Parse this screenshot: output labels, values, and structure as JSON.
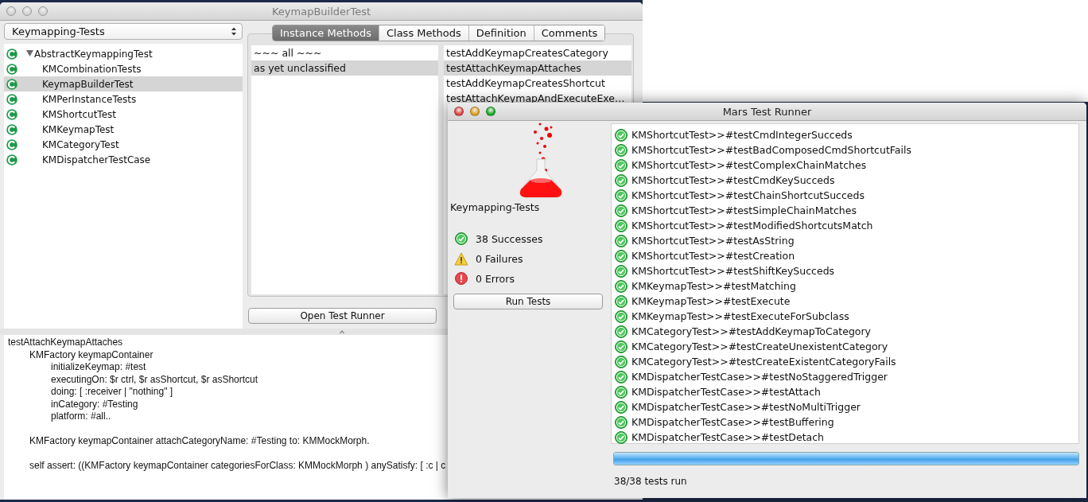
{
  "browser_window": {
    "title": "KeymapBuilderTest",
    "active": false,
    "package_dropdown": {
      "value": "Keymapping-Tests"
    },
    "class_tree": [
      {
        "name": "AbstractKeymappingTest",
        "selected": false,
        "expanded": true,
        "children": [
          {
            "name": "KMCombinationTests",
            "selected": false
          },
          {
            "name": "KeymapBuilderTest",
            "selected": true
          },
          {
            "name": "KMPerInstanceTests",
            "selected": false
          },
          {
            "name": "KMShortcutTest",
            "selected": false
          },
          {
            "name": "KMKeymapTest",
            "selected": false
          },
          {
            "name": "KMCategoryTest",
            "selected": false
          },
          {
            "name": "KMDispatcherTestCase",
            "selected": false
          }
        ]
      }
    ],
    "tabs": [
      {
        "label": "Instance Methods",
        "selected": true
      },
      {
        "label": "Class Methods",
        "selected": false
      },
      {
        "label": "Definition",
        "selected": false
      },
      {
        "label": "Comments",
        "selected": false
      }
    ],
    "protocols": [
      {
        "label": "~~~ all ~~~",
        "selected": false
      },
      {
        "label": "as yet unclassified",
        "selected": true
      }
    ],
    "methods": [
      {
        "label": "testAddKeymapCreatesCategory",
        "selected": false
      },
      {
        "label": "testAttachKeymapAttaches",
        "selected": true
      },
      {
        "label": "testAddKeymapCreatesShortcut",
        "selected": false
      },
      {
        "label": "testAttachKeymapAndExecuteExe…",
        "selected": false
      }
    ],
    "open_test_runner_button": "Open Test Runner",
    "source_code": "testAttachKeymapAttaches\n\tKMFactory keymapContainer\n\t\tinitializeKeymap: #test\n\t\texecutingOn: $r ctrl, $r asShortcut, $r asShortcut\n\t\tdoing: [ :receiver | \"nothing\" ]\n\t\tinCategory: #Testing\n\t\tplatform: #all..\n\n\tKMFactory keymapContainer attachCategoryName: #Testing to: KMMockMorph.\n\n\tself assert: ((KMFactory keymapContainer categoriesForClass: KMMockMorph ) anySatisfy: [ :c | c"
  },
  "test_runner_window": {
    "title": "Mars Test Runner",
    "active": true,
    "package_name": "Keymapping-Tests",
    "summary": [
      {
        "kind": "success",
        "text": "38 Successes"
      },
      {
        "kind": "failure",
        "text": "0 Failures"
      },
      {
        "kind": "error",
        "text": "0 Errors"
      }
    ],
    "run_button": "Run Tests",
    "results": [
      {
        "kind": "pass",
        "label": "KMShortcutTest>>#testCmdIntegerSucceds"
      },
      {
        "kind": "pass",
        "label": "KMShortcutTest>>#testBadComposedCmdShortcutFails"
      },
      {
        "kind": "pass",
        "label": "KMShortcutTest>>#testComplexChainMatches"
      },
      {
        "kind": "pass",
        "label": "KMShortcutTest>>#testCmdKeySucceds"
      },
      {
        "kind": "pass",
        "label": "KMShortcutTest>>#testChainShortcutSucceds"
      },
      {
        "kind": "pass",
        "label": "KMShortcutTest>>#testSimpleChainMatches"
      },
      {
        "kind": "pass",
        "label": "KMShortcutTest>>#testModifiedShortcutsMatch"
      },
      {
        "kind": "pass",
        "label": "KMShortcutTest>>#testAsString"
      },
      {
        "kind": "pass",
        "label": "KMShortcutTest>>#testCreation"
      },
      {
        "kind": "pass",
        "label": "KMShortcutTest>>#testShiftKeySucceds"
      },
      {
        "kind": "pass",
        "label": "KMKeymapTest>>#testMatching"
      },
      {
        "kind": "pass",
        "label": "KMKeymapTest>>#testExecute"
      },
      {
        "kind": "pass",
        "label": "KMKeymapTest>>#testExecuteForSubclass"
      },
      {
        "kind": "pass",
        "label": "KMCategoryTest>>#testAddKeymapToCategory"
      },
      {
        "kind": "pass",
        "label": "KMCategoryTest>>#testCreateUnexistentCategory"
      },
      {
        "kind": "pass",
        "label": "KMCategoryTest>>#testCreateExistentCategoryFails"
      },
      {
        "kind": "pass",
        "label": "KMDispatcherTestCase>>#testNoStaggeredTrigger"
      },
      {
        "kind": "pass",
        "label": "KMDispatcherTestCase>>#testAttach"
      },
      {
        "kind": "pass",
        "label": "KMDispatcherTestCase>>#testNoMultiTrigger"
      },
      {
        "kind": "pass",
        "label": "KMDispatcherTestCase>>#testBuffering"
      },
      {
        "kind": "pass",
        "label": "KMDispatcherTestCase>>#testDetach"
      }
    ],
    "progress": {
      "level": 1
    },
    "status": "38/38 tests run"
  }
}
